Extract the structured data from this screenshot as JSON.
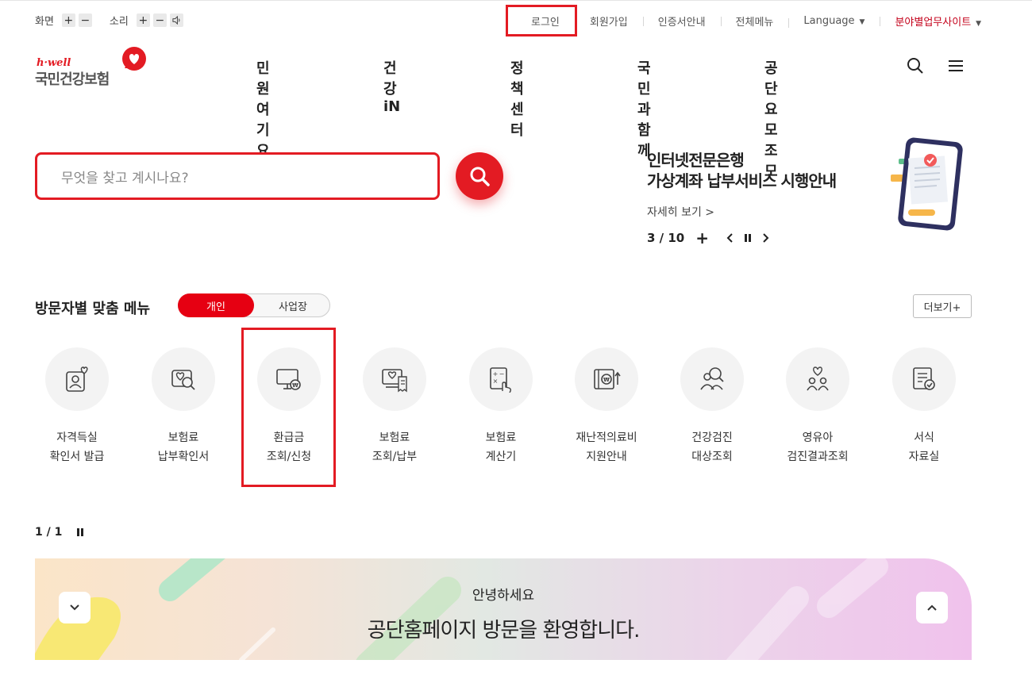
{
  "utility": {
    "screen_label": "화면",
    "sound_label": "소리",
    "plus": "+",
    "minus": "−",
    "login": "로그인",
    "signup": "회원가입",
    "cert": "인증서안내",
    "all_menu": "전체메뉴",
    "language": "Language",
    "field_sites": "분야별업무사이트"
  },
  "logo": {
    "tagline": "h·well",
    "name": "국민건강보험"
  },
  "nav": [
    "민원여기요",
    "건강iN",
    "정책센터",
    "국민과함께",
    "공단요모조모"
  ],
  "search": {
    "placeholder": "무엇을 찾고 계시나요?"
  },
  "promo": {
    "title_line1": "인터넷전문은행",
    "title_line2": "가상계좌 납부서비스 시행안내",
    "more": "자세히 보기 >",
    "page": "3 / 10",
    "plus": "+"
  },
  "visitor_menu": {
    "title": "방문자별 맞춤 메뉴",
    "toggle_personal": "개인",
    "toggle_business": "사업장",
    "more": "더보기+",
    "items": [
      {
        "l1": "자격득실",
        "l2": "확인서 발급",
        "icon": "person-heart-icon"
      },
      {
        "l1": "보험료",
        "l2": "납부확인서",
        "icon": "doc-search-icon"
      },
      {
        "l1": "환급금",
        "l2": "조회/신청",
        "icon": "monitor-won-icon"
      },
      {
        "l1": "보험료",
        "l2": "조회/납부",
        "icon": "monitor-receipt-icon"
      },
      {
        "l1": "보험료",
        "l2": "계산기",
        "icon": "calculator-hand-icon"
      },
      {
        "l1": "재난적의료비",
        "l2": "지원안내",
        "icon": "won-arrow-icon"
      },
      {
        "l1": "건강검진",
        "l2": "대상조회",
        "icon": "people-search-icon"
      },
      {
        "l1": "영유아",
        "l2": "검진결과조회",
        "icon": "children-heart-icon"
      },
      {
        "l1": "서식",
        "l2": "자료실",
        "icon": "form-check-icon"
      }
    ],
    "page": "1 / 1"
  },
  "banner": {
    "greeting": "안녕하세요",
    "welcome": "공단홈페이지 방문을 환영합니다."
  },
  "colors": {
    "brand_red": "#e31b23",
    "toggle_red": "#e60012"
  }
}
